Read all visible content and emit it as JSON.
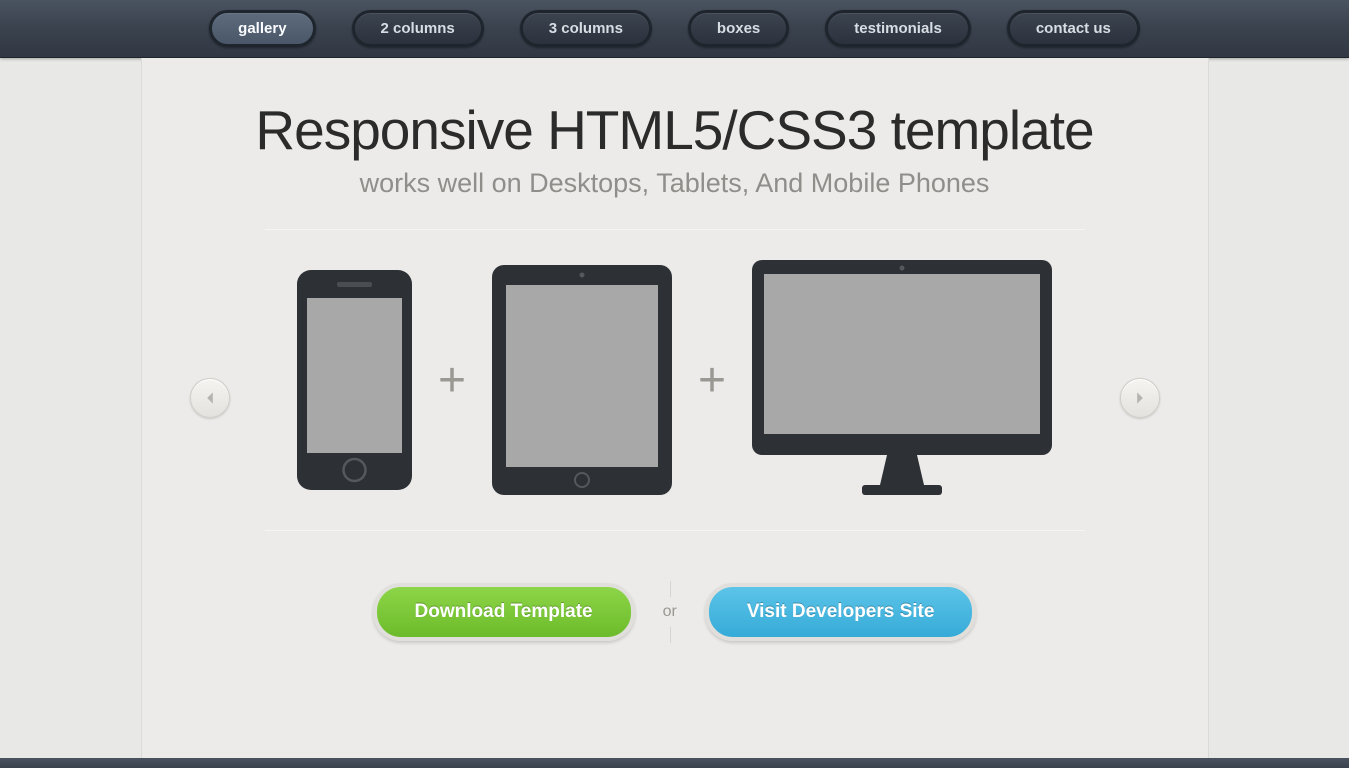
{
  "nav": {
    "items": [
      {
        "label": "gallery",
        "active": true
      },
      {
        "label": "2 columns",
        "active": false
      },
      {
        "label": "3 columns",
        "active": false
      },
      {
        "label": "boxes",
        "active": false
      },
      {
        "label": "testimonials",
        "active": false
      },
      {
        "label": "contact us",
        "active": false
      }
    ]
  },
  "hero": {
    "title": "Responsive HTML5/CSS3 template",
    "subtitle": "works well on Desktops, Tablets, And Mobile Phones"
  },
  "gallery": {
    "plus1": "+",
    "plus2": "+"
  },
  "cta": {
    "download_label": "Download Template",
    "or_label": "or",
    "visit_label": "Visit Developers Site"
  },
  "colors": {
    "nav_bg": "#3a424e",
    "green": "#6cbb2b",
    "blue": "#36abd8",
    "device_dark": "#2d3034",
    "device_screen": "#a8a8a8"
  }
}
